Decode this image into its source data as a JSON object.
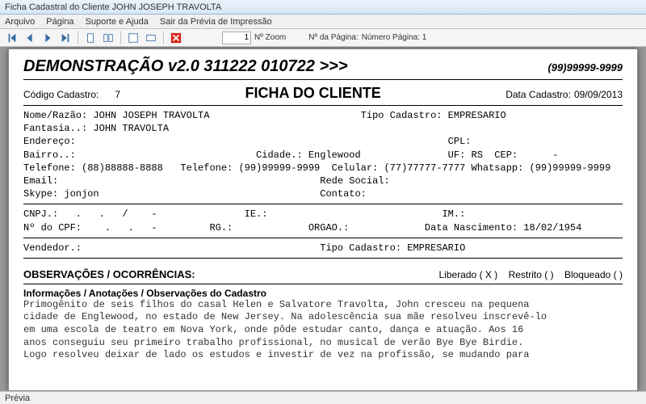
{
  "window": {
    "title": "Ficha Cadastral do Cliente JOHN JOSEPH TRAVOLTA"
  },
  "menu": {
    "arquivo": "Arquivo",
    "pagina": "Página",
    "suporte": "Suporte e Ajuda",
    "sair": "Sair da Prévia de Impressão"
  },
  "toolbar": {
    "zoom_value": "1",
    "zoom_label": "Nº Zoom",
    "page_label": "Nº da Página:",
    "page_value": "Número Página: 1"
  },
  "header": {
    "demo": "DEMONSTRAÇÃO v2.0 311222 010722 >>>",
    "phone": "(99)99999-9999"
  },
  "subheader": {
    "code_label": "Código Cadastro:",
    "code_value": "7",
    "title": "FICHA DO CLIENTE",
    "date_label": "Data Cadastro:",
    "date_value": "09/09/2013"
  },
  "fields": {
    "line1": "Nome/Razão: JOHN JOSEPH TRAVOLTA                          Tipo Cadastro: EMPRESARIO",
    "line2": "Fantasia..: JOHN TRAVOLTA",
    "line3": "Endereço:                                                                CPL:",
    "line4": "Bairro..:                               Cidade.: Englewood               UF: RS  CEP:      -",
    "line5": "Telefone: (88)88888-8888   Telefone: (99)99999-9999  Celular: (77)77777-7777 Whatsapp: (99)99999-9999",
    "line6": "Email:                                             Rede Social:",
    "line7": "Skype: jonjon                                      Contato:"
  },
  "docs": {
    "line1": "CNPJ.:   .   .   /    -               IE.:                              IM.:",
    "line2": "Nº do CPF:    .   .   -         RG.:             ORGAO.:             Data Nascimento: 18/02/1954"
  },
  "seller": {
    "line": "Vendedor.:                                         Tipo Cadastro: EMPRESARIO"
  },
  "obs": {
    "title": "OBSERVAÇÕES / OCORRÊNCIAS:",
    "liberado_label": "Liberado",
    "liberado_value": "( X )",
    "restrito_label": "Restrito",
    "restrito_value": "(   )",
    "bloqueado_label": "Bloqueado",
    "bloqueado_value": "(   )"
  },
  "info": {
    "title": "Informações / Anotações / Observações do Cadastro",
    "notes": "Primogênito de seis filhos do casal Helen e Salvatore Travolta, John cresceu na pequena\ncidade de Englewood, no estado de New Jersey. Na adolescência sua mãe resolveu inscrevê-lo\nem uma escola de teatro em Nova York, onde pôde estudar canto, dança e atuação. Aos 16\nanos conseguiu seu primeiro trabalho profissional, no musical de verão Bye Bye Birdie.\nLogo resolveu deixar de lado os estudos e investir de vez na profissão, se mudando para"
  },
  "status": {
    "text": "Prévia"
  }
}
